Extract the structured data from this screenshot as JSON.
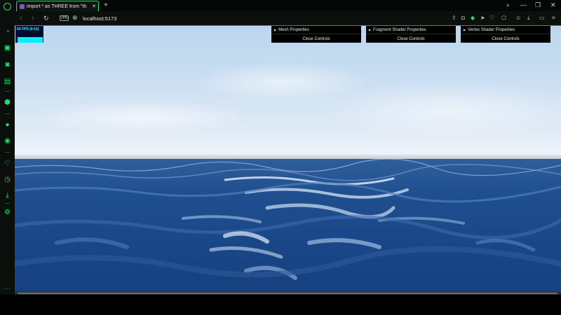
{
  "browser": {
    "tab": {
      "title": "import * as THREE from \"th"
    },
    "address": {
      "vpn_label": "VPN",
      "url": "localhost:5173"
    }
  },
  "sidebar": {
    "icons": [
      "opera-gx-logo-icon",
      "speed-dial-icon",
      "shopping-bag-icon",
      "twitch-icon",
      "player-icon",
      "chatgpt-icon",
      "messenger-icon",
      "discord-icon",
      "heart-icon",
      "history-icon",
      "download-icon",
      "settings-icon",
      "more-icon"
    ]
  },
  "stats": {
    "fps_label": "60 FPS (0-61)"
  },
  "gui_panels": [
    {
      "title": "Mesh Properties",
      "close_label": "Close Controls"
    },
    {
      "title": "Fragment Shader Properties",
      "close_label": "Close Controls"
    },
    {
      "title": "Vertex Shader Properties",
      "close_label": "Close Controls"
    }
  ],
  "colors": {
    "accent": "#19e36a",
    "sky_top": "#bcd6ef",
    "ocean": "#1b4889",
    "stats_bg": "#020a2a",
    "stats_fg": "#00ffff"
  }
}
